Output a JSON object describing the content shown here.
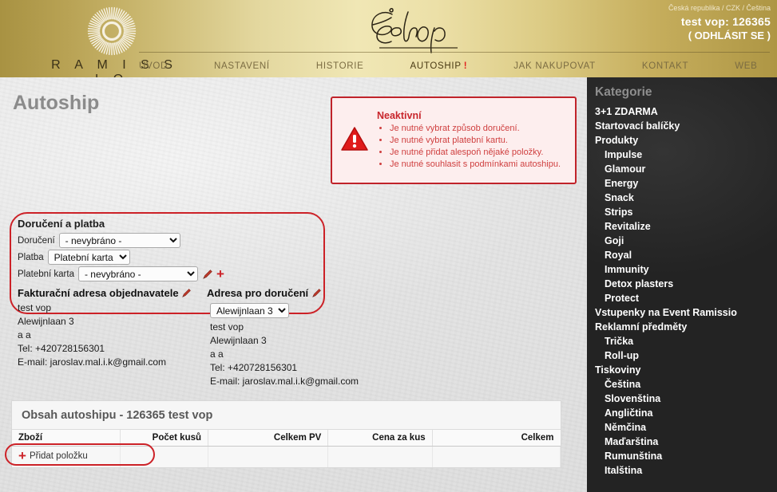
{
  "header": {
    "brand": "R A M I S S I O",
    "logo_icon": "sunburst-icon",
    "eshop_logo": "Eshop",
    "locale": "Česká republika / CZK / Čeština",
    "user": "test vop: 126365",
    "logout": "( ODHLÁSIT SE )",
    "nav": [
      {
        "label": "ÚVOD",
        "active": false
      },
      {
        "label": "NASTAVENÍ",
        "active": false
      },
      {
        "label": "HISTORIE",
        "active": false
      },
      {
        "label": "AUTOSHIP",
        "active": true,
        "badge": "!"
      },
      {
        "label": "JAK NAKUPOVAT",
        "active": false
      },
      {
        "label": "KONTAKT",
        "active": false
      },
      {
        "label": "WEB",
        "active": false
      }
    ]
  },
  "page": {
    "title": "Autoship"
  },
  "alert": {
    "icon": "warning-triangle-icon",
    "title": "Neaktivní",
    "items": [
      "Je nutné vybrat způsob doručení.",
      "Je nutné vybrat platební kartu.",
      "Je nutné přidat alespoň nějaké položky.",
      "Je nutné souhlasit s podmínkami autoshipu."
    ],
    "border_color": "#c0232a",
    "bg_color": "#fdeeee"
  },
  "delivery": {
    "section_title": "Doručení a platba",
    "highlight_color": "#cc2127",
    "rows": [
      {
        "label": "Doručení",
        "value": "- nevybráno -",
        "options": [
          "- nevybráno -"
        ]
      },
      {
        "label": "Platba",
        "value": "Platební karta",
        "options": [
          "Platební karta"
        ]
      },
      {
        "label": "Platební karta",
        "value": "- nevybráno -",
        "options": [
          "- nevybráno -"
        ]
      }
    ],
    "card_edit_icon": "pencil-icon",
    "card_add_icon": "plus-icon"
  },
  "billing": {
    "title": "Fakturační adresa objednavatele",
    "edit_icon": "pencil-icon",
    "lines": [
      "test vop",
      "Alewijnlaan 3",
      "a a",
      "Tel: +420728156301",
      "E-mail: jaroslav.mal.i.k@gmail.com"
    ]
  },
  "shipping": {
    "title": "Adresa pro doručení",
    "edit_icon": "pencil-icon",
    "selected": "Alewijnlaan 3",
    "options": [
      "Alewijnlaan 3"
    ],
    "lines": [
      "test vop",
      "Alewijnlaan 3",
      "a a",
      "Tel: +420728156301",
      "E-mail: jaroslav.mal.i.k@gmail.com"
    ]
  },
  "autoship_table": {
    "heading": "Obsah autoshipu - 126365 test vop",
    "columns": [
      "Zboží",
      "Počet kusů",
      "Celkem PV",
      "Cena za kus",
      "Celkem"
    ],
    "rows": [],
    "add_item_label": "Přidat položku",
    "add_item_icon": "plus-icon"
  },
  "sidebar": {
    "title": "Kategorie",
    "items": [
      {
        "label": "3+1 ZDARMA",
        "level": 1
      },
      {
        "label": "Startovací balíčky",
        "level": 1
      },
      {
        "label": "Produkty",
        "level": 1
      },
      {
        "label": "Impulse",
        "level": 2
      },
      {
        "label": "Glamour",
        "level": 2
      },
      {
        "label": "Energy",
        "level": 2
      },
      {
        "label": "Snack",
        "level": 2
      },
      {
        "label": "Strips",
        "level": 2
      },
      {
        "label": "Revitalize",
        "level": 2
      },
      {
        "label": "Goji",
        "level": 2
      },
      {
        "label": "Royal",
        "level": 2
      },
      {
        "label": "Immunity",
        "level": 2
      },
      {
        "label": "Detox plasters",
        "level": 2
      },
      {
        "label": "Protect",
        "level": 2
      },
      {
        "label": "Vstupenky na Event Ramissio",
        "level": 1
      },
      {
        "label": "Reklamní předměty",
        "level": 1
      },
      {
        "label": "Trička",
        "level": 2
      },
      {
        "label": "Roll-up",
        "level": 2
      },
      {
        "label": "Tiskoviny",
        "level": 1
      },
      {
        "label": "Čeština",
        "level": 2
      },
      {
        "label": "Slovenština",
        "level": 2
      },
      {
        "label": "Angličtina",
        "level": 2
      },
      {
        "label": "Němčina",
        "level": 2
      },
      {
        "label": "Maďarština",
        "level": 2
      },
      {
        "label": "Rumunština",
        "level": 2
      },
      {
        "label": "Italština",
        "level": 2
      }
    ]
  }
}
